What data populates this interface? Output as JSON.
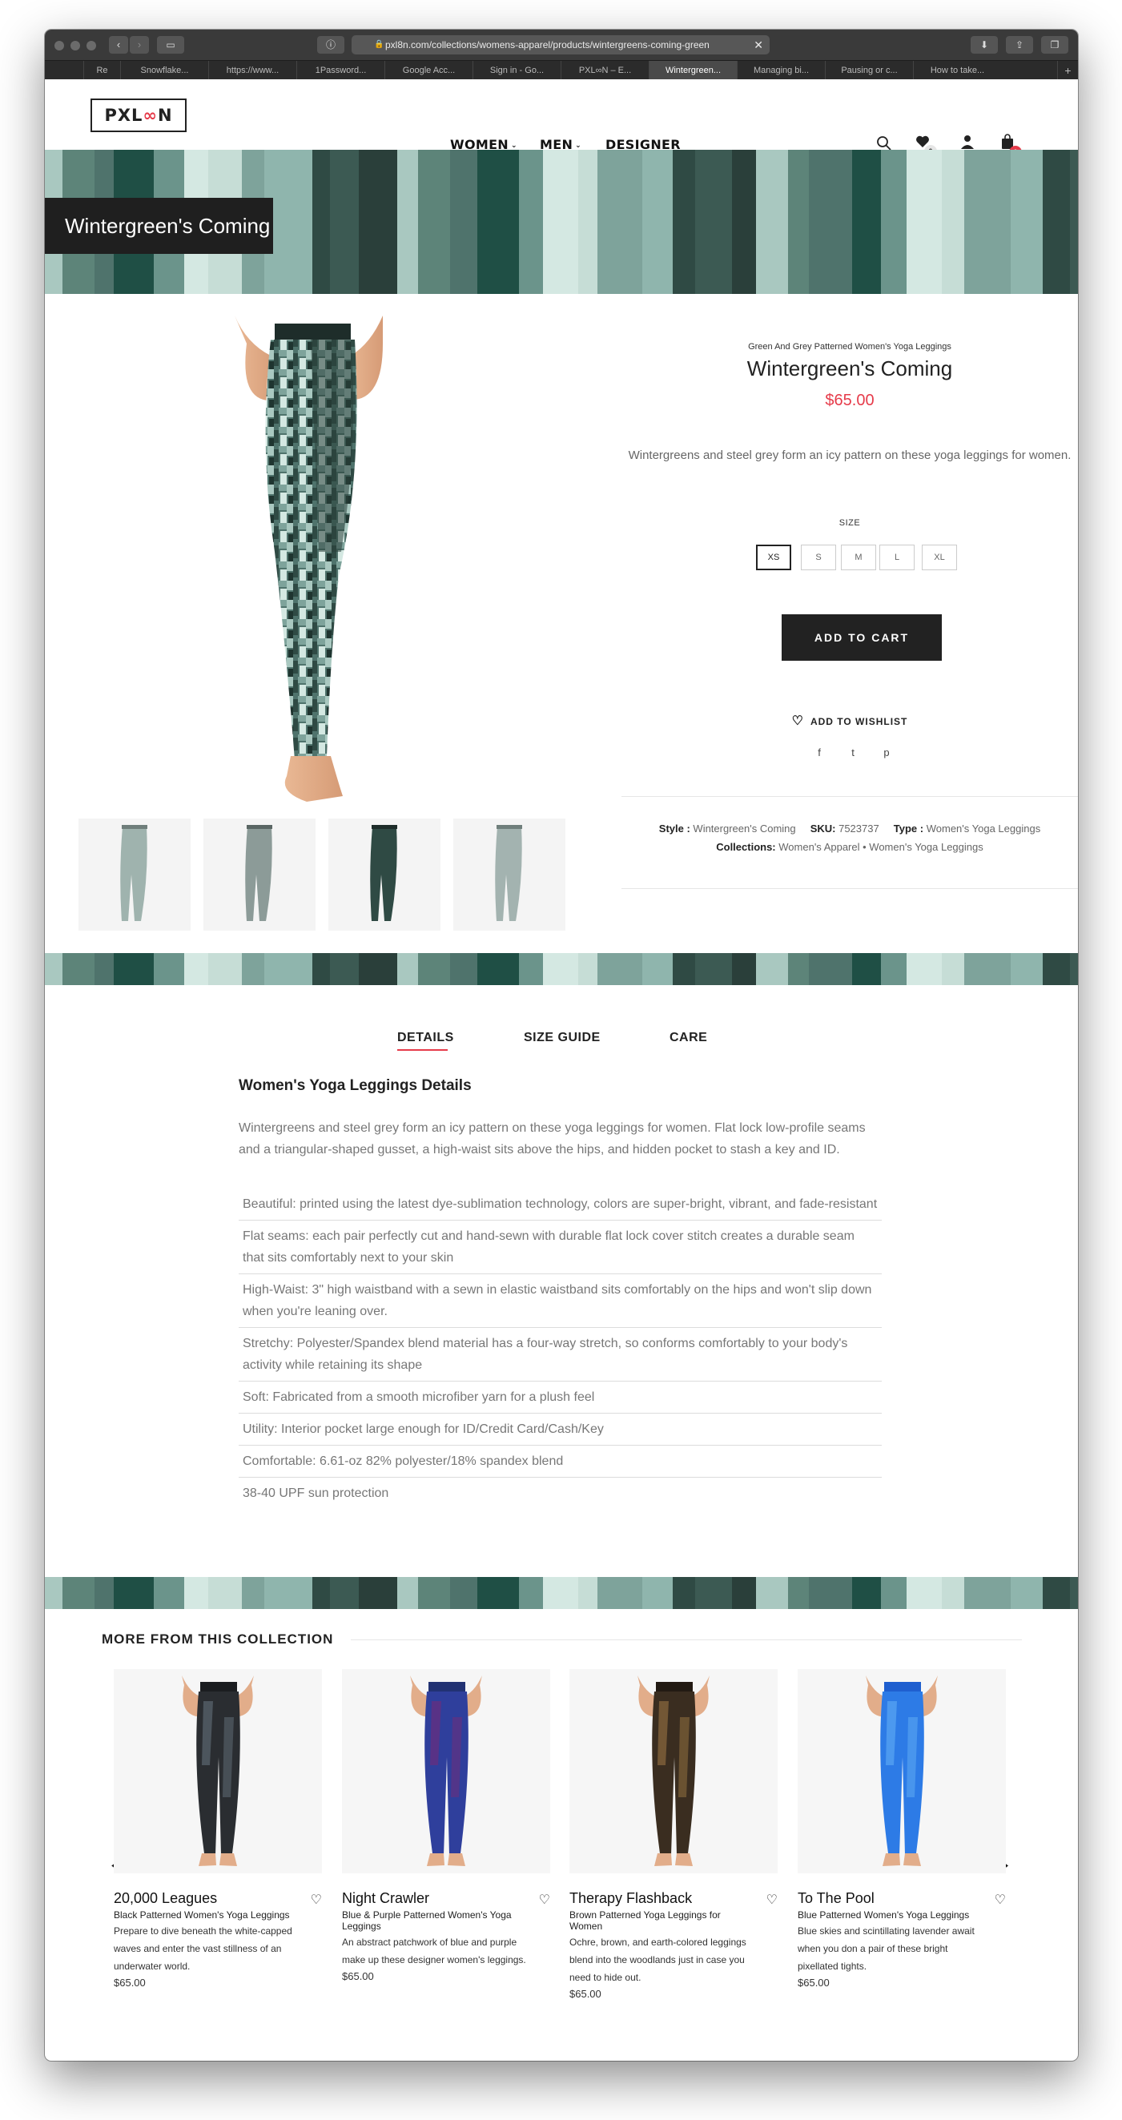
{
  "browser": {
    "url": "pxl8n.com/collections/womens-apparel/products/wintergreens-coming-green",
    "tabs": [
      {
        "label": "Re",
        "active": false
      },
      {
        "label": "Snowflake...",
        "active": false
      },
      {
        "label": "https://www...",
        "active": false
      },
      {
        "label": "1Password...",
        "active": false
      },
      {
        "label": "Google Acc...",
        "active": false
      },
      {
        "label": "Sign in - Go...",
        "active": false
      },
      {
        "label": "PXL∞N – E...",
        "active": false
      },
      {
        "label": "Wintergreen...",
        "active": true
      },
      {
        "label": "Managing bi...",
        "active": false
      },
      {
        "label": "Pausing or c...",
        "active": false
      },
      {
        "label": "How to take...",
        "active": false
      }
    ],
    "new_tab_label": "+"
  },
  "header": {
    "logo_left": "PXL",
    "logo_mark": "∞",
    "logo_right": "N",
    "nav": [
      {
        "label": "WOMEN",
        "has_dropdown": true
      },
      {
        "label": "MEN",
        "has_dropdown": true
      },
      {
        "label": "DESIGNER",
        "has_dropdown": false
      }
    ],
    "wishlist_count": "0",
    "cart_count": "0"
  },
  "banner": {
    "title": "Wintergreen's Coming"
  },
  "product": {
    "subtitle": "Green And Grey Patterned Women's Yoga Leggings",
    "title": "Wintergreen's Coming",
    "price": "$65.00",
    "description": "Wintergreens and steel grey form an icy pattern on these yoga leggings for women.",
    "size_label": "SIZE",
    "sizes": [
      "XS",
      "S",
      "M",
      "L",
      "XL"
    ],
    "selected_size": "XS",
    "add_to_cart": "ADD TO CART",
    "wishlist": "ADD TO WISHLIST",
    "style_label": "Style :",
    "style_value": "Wintergreen's Coming",
    "sku_label": "SKU:",
    "sku_value": "7523737",
    "type_label": "Type :",
    "type_value": "Women's Yoga Leggings",
    "collections_label": "Collections:",
    "collections_value": "Women's Apparel • Women's Yoga Leggings"
  },
  "tabs": [
    {
      "label": "DETAILS",
      "active": true
    },
    {
      "label": "SIZE GUIDE",
      "active": false
    },
    {
      "label": "CARE",
      "active": false
    }
  ],
  "details": {
    "heading": "Women's Yoga Leggings Details",
    "intro": "Wintergreens and steel grey form an icy pattern on these yoga leggings for women. Flat lock low-profile seams and a triangular-shaped gusset, a high-waist sits above the hips, and hidden pocket to stash a key and ID.",
    "features": [
      "Beautiful: printed using the latest dye-sublimation technology, colors are super-bright, vibrant, and fade-resistant",
      "Flat seams: each pair perfectly cut and hand-sewn with durable flat lock cover stitch creates a durable seam that sits comfortably next to your skin",
      "High-Waist: 3\" high waistband with a sewn in elastic waistband sits comfortably on the hips and won't slip down when you're leaning over.",
      "Stretchy: Polyester/Spandex blend material has a four-way stretch, so conforms comfortably to your body's activity while retaining its shape",
      "Soft: Fabricated from a smooth microfiber yarn for a plush feel",
      "Utility: Interior pocket large enough for ID/Credit Card/Cash/Key",
      "Comfortable: 6.61-oz 82% polyester/18% spandex blend",
      "38-40 UPF sun protection"
    ]
  },
  "related": {
    "heading": "MORE FROM THIS COLLECTION",
    "prev_arrow": "←",
    "next_arrow": "→",
    "items": [
      {
        "name": "20,000 Leagues",
        "subtitle": "Black Patterned Women's Yoga Leggings",
        "description": "Prepare to dive beneath the white-capped waves and enter the vast stillness of an underwater world.",
        "price": "$65.00",
        "colors": [
          "#2a2d31",
          "#5b6670",
          "#1b1d20"
        ]
      },
      {
        "name": "Night Crawler",
        "subtitle": "Blue & Purple Patterned Women's Yoga Leggings",
        "description": "An abstract patchwork of blue and purple make up these designer women's leggings.",
        "price": "$65.00",
        "colors": [
          "#2f3f9c",
          "#6a2e7d",
          "#223273"
        ]
      },
      {
        "name": "Therapy Flashback",
        "subtitle": "Brown Patterned Yoga Leggings for Women",
        "description": "Ochre, brown, and earth-colored leggings blend into the woodlands just in case you need to hide out.",
        "price": "$65.00",
        "colors": [
          "#3a2d20",
          "#8b6a3e",
          "#221a13"
        ]
      },
      {
        "name": "To The Pool",
        "subtitle": "Blue Patterned Women's Yoga Leggings",
        "description": "Blue skies and scintillating lavender await when you don a pair of these bright pixellated tights.",
        "price": "$65.00",
        "colors": [
          "#2d7be6",
          "#5aa6f2",
          "#1f5fcf"
        ]
      }
    ]
  },
  "colors": {
    "accent": "#e63b4a",
    "dark": "#222222",
    "banner_palette": [
      "#2f4a44",
      "#4f736c",
      "#7ea39b",
      "#a9c8c0",
      "#d4e8e2",
      "#3c5a53",
      "#1f4f45",
      "#8fb5ad",
      "#5d8479",
      "#c6ddd6",
      "#2a3f3a",
      "#6b948b"
    ]
  }
}
